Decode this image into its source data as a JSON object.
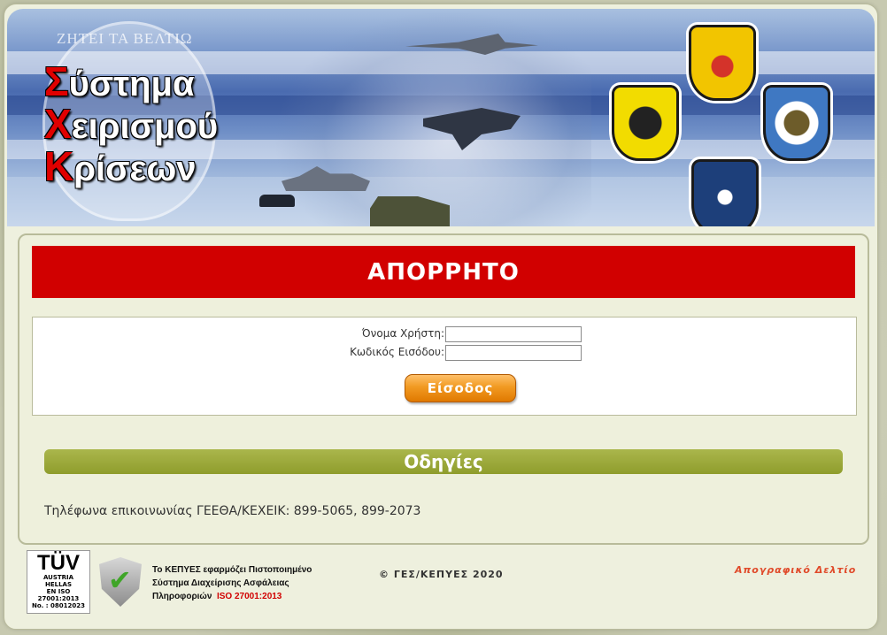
{
  "banner": {
    "motto": "ΖΗΤΕΙ ΤΑ ΒΕΛΤΙΩ",
    "title_lines": [
      {
        "cap": "Σ",
        "rest": "ύστημα"
      },
      {
        "cap": "Χ",
        "rest": "ειρισμού"
      },
      {
        "cap": "Κ",
        "rest": "ρίσεων"
      }
    ],
    "badges": [
      "army-badge-icon",
      "hellenic-army-badge-icon",
      "air-force-badge-icon",
      "navy-badge-icon"
    ]
  },
  "classification": "ΑΠΟΡΡΗΤΟ",
  "login": {
    "username_label": "Όνομα Χρήστη:",
    "password_label": "Κωδικός Εισόδου:",
    "username_value": "",
    "password_value": "",
    "submit_label": "Είσοδος"
  },
  "guide_label": "Οδηγίες",
  "contact_text": "Τηλέφωνα επικοινωνίας ΓΕΕΘΑ/ΚΕΧΕΙΚ: 899-5065, 899-2073",
  "footer": {
    "tuv_logo": "TÜV",
    "tuv_line1": "AUSTRIA",
    "tuv_line2": "HELLAS",
    "tuv_line3": "EN ISO 27001:2013",
    "tuv_line4": "No. : 08012023",
    "iso_line1": "Το ΚΕΠΥΕΣ εφαρμόζει Πιστοποιημένο",
    "iso_line2": "Σύστημα Διαχείρισης Ασφάλειας",
    "iso_line3": "Πληροφοριών",
    "iso_highlight": "ISO 27001:2013",
    "copyright": "© ΓΕΣ/ΚΕΠΥΕΣ 2020",
    "asset_link": "Απογραφικό Δελτίο"
  },
  "colors": {
    "classified_red": "#d10000",
    "guide_olive": "#8f9d2c",
    "button_orange": "#f19a22"
  }
}
